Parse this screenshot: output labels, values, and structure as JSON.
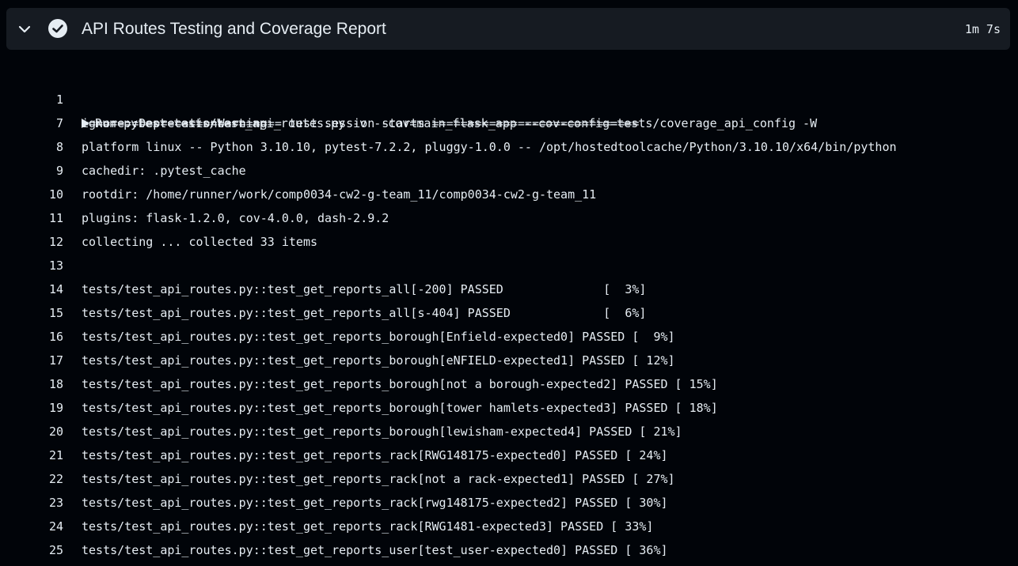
{
  "step": {
    "title": "API Routes Testing and Coverage Report",
    "duration": "1m 7s",
    "status": "success",
    "icons": {
      "collapse": "chevron-down-icon",
      "status": "check-circle-icon"
    },
    "colors": {
      "background": "#010409",
      "header_background": "#161b22",
      "text": "#e6edf3"
    }
  },
  "log": {
    "run_command": "Run pytest tests/test_api_routes.py -v --cov=main_flask_app --cov-config=tests/coverage_api_config -W",
    "run_command_cont": "ignore::DeprecationWarning",
    "lines": [
      {
        "n": "7",
        "text": "============================ test session starts ============================="
      },
      {
        "n": "8",
        "text": "platform linux -- Python 3.10.10, pytest-7.2.2, pluggy-1.0.0 -- /opt/hostedtoolcache/Python/3.10.10/x64/bin/python"
      },
      {
        "n": "9",
        "text": "cachedir: .pytest_cache"
      },
      {
        "n": "10",
        "text": "rootdir: /home/runner/work/comp0034-cw2-g-team_11/comp0034-cw2-g-team_11"
      },
      {
        "n": "11",
        "text": "plugins: flask-1.2.0, cov-4.0.0, dash-2.9.2"
      },
      {
        "n": "12",
        "text": "collecting ... collected 33 items"
      },
      {
        "n": "13",
        "text": ""
      },
      {
        "n": "14",
        "text": "tests/test_api_routes.py::test_get_reports_all[-200] PASSED              [  3%]"
      },
      {
        "n": "15",
        "text": "tests/test_api_routes.py::test_get_reports_all[s-404] PASSED             [  6%]"
      },
      {
        "n": "16",
        "text": "tests/test_api_routes.py::test_get_reports_borough[Enfield-expected0] PASSED [  9%]"
      },
      {
        "n": "17",
        "text": "tests/test_api_routes.py::test_get_reports_borough[eNFIELD-expected1] PASSED [ 12%]"
      },
      {
        "n": "18",
        "text": "tests/test_api_routes.py::test_get_reports_borough[not a borough-expected2] PASSED [ 15%]"
      },
      {
        "n": "19",
        "text": "tests/test_api_routes.py::test_get_reports_borough[tower hamlets-expected3] PASSED [ 18%]"
      },
      {
        "n": "20",
        "text": "tests/test_api_routes.py::test_get_reports_borough[lewisham-expected4] PASSED [ 21%]"
      },
      {
        "n": "21",
        "text": "tests/test_api_routes.py::test_get_reports_rack[RWG148175-expected0] PASSED [ 24%]"
      },
      {
        "n": "22",
        "text": "tests/test_api_routes.py::test_get_reports_rack[not a rack-expected1] PASSED [ 27%]"
      },
      {
        "n": "23",
        "text": "tests/test_api_routes.py::test_get_reports_rack[rwg148175-expected2] PASSED [ 30%]"
      },
      {
        "n": "24",
        "text": "tests/test_api_routes.py::test_get_reports_rack[RWG1481-expected3] PASSED [ 33%]"
      },
      {
        "n": "25",
        "text": "tests/test_api_routes.py::test_get_reports_user[test_user-expected0] PASSED [ 36%]"
      }
    ]
  }
}
